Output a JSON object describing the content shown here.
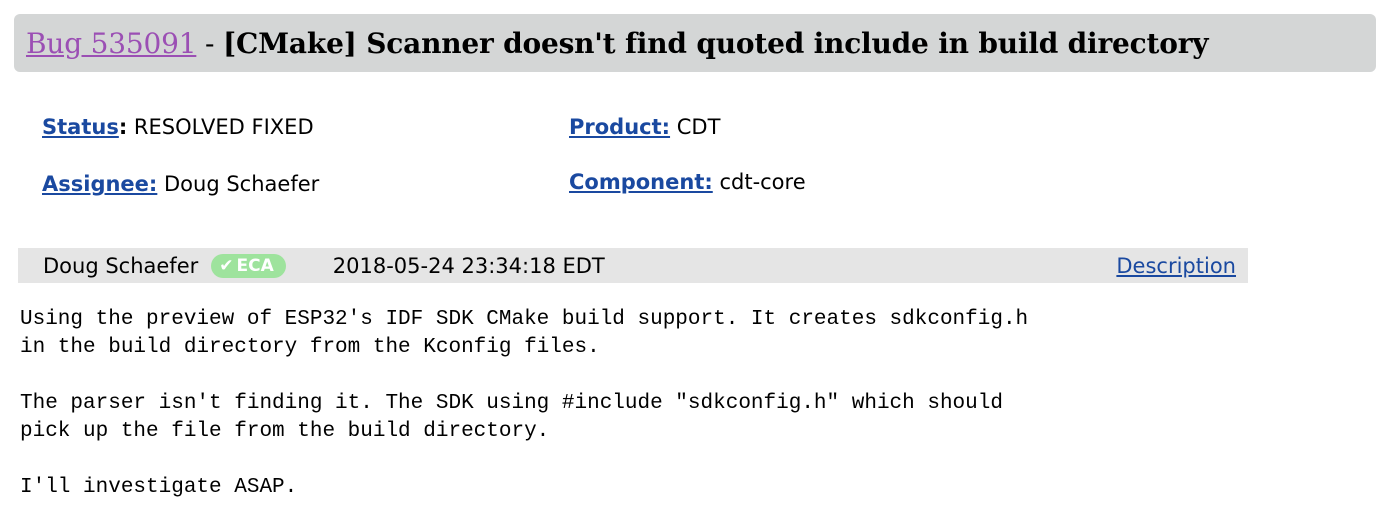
{
  "bug": {
    "link_text": "Bug 535091",
    "separator": "-",
    "summary": "[CMake] Scanner doesn't find quoted include in build directory"
  },
  "fields": {
    "status": {
      "label": "Status",
      "colon": ":",
      "value": "RESOLVED FIXED"
    },
    "product": {
      "label": "Product:",
      "value": "CDT"
    },
    "assignee": {
      "label": "Assignee:",
      "value": "Doug Schaefer"
    },
    "component": {
      "label": "Component:",
      "value": "cdt-core"
    }
  },
  "comment": {
    "author": "Doug Schaefer",
    "badge": {
      "check": "✔",
      "text": "ECA"
    },
    "timestamp": "2018-05-24 23:34:18 EDT",
    "description_link": "Description",
    "lines": [
      "Using the preview of ESP32's IDF SDK CMake build support. It creates sdkconfig.h",
      "in the build directory from the Kconfig files.",
      "",
      "The parser isn't finding it. The SDK using #include \"sdkconfig.h\" which should",
      "pick up the file from the build directory.",
      "",
      "I'll investigate ASAP."
    ]
  },
  "colors": {
    "title_bar_bg": "#d4d6d6",
    "visited_link": "#9b4fb4",
    "link": "#1a49a0",
    "comment_header_bg": "#e5e5e5",
    "eca_badge_bg": "#9ee39d"
  }
}
